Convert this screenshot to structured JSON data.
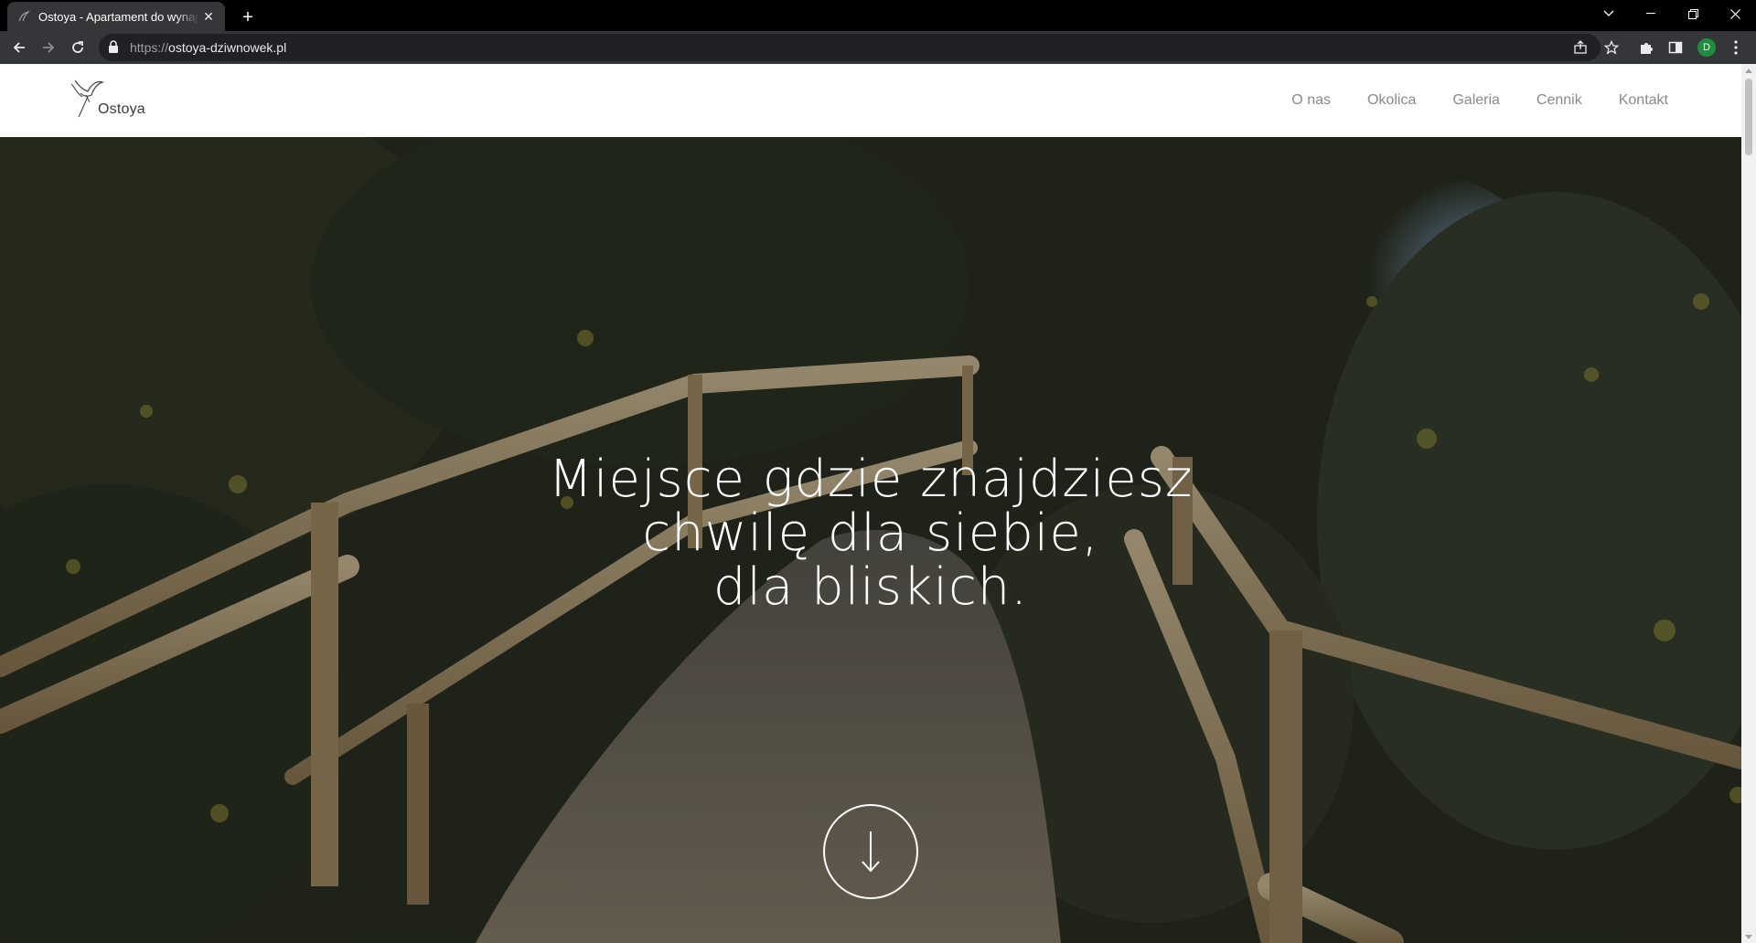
{
  "browser": {
    "tab": {
      "title": "Ostoya - Apartament do wynajęcia",
      "close": "✕"
    },
    "new_tab": "+",
    "url_scheme": "https://",
    "url_host": "ostoya-dziwnowek.pl",
    "profile_initial": "D"
  },
  "site": {
    "logo_text": "Ostoya",
    "nav": [
      {
        "label": "O nas"
      },
      {
        "label": "Okolica"
      },
      {
        "label": "Galeria"
      },
      {
        "label": "Cennik"
      },
      {
        "label": "Kontakt"
      }
    ],
    "hero": {
      "title_lines": [
        "Miejsce gdzie znajdziesz",
        "chwilę dla siebie,",
        "dla bliskich."
      ]
    }
  },
  "colors": {
    "chrome_dark": "#000000",
    "toolbar": "#35363a",
    "omnibox": "#202124",
    "header_bg": "#ffffff",
    "nav_text": "#8a8a8a",
    "profile_green": "#1e8e3e"
  },
  "icons": {
    "back": "back-arrow-icon",
    "forward": "forward-arrow-icon",
    "reload": "reload-icon",
    "lock": "lock-icon",
    "share": "share-icon",
    "star": "bookmark-star-icon",
    "extensions": "puzzle-icon",
    "sidepanel": "side-panel-icon",
    "menu": "kebab-menu-icon",
    "scroll": "arrow-down-icon"
  }
}
